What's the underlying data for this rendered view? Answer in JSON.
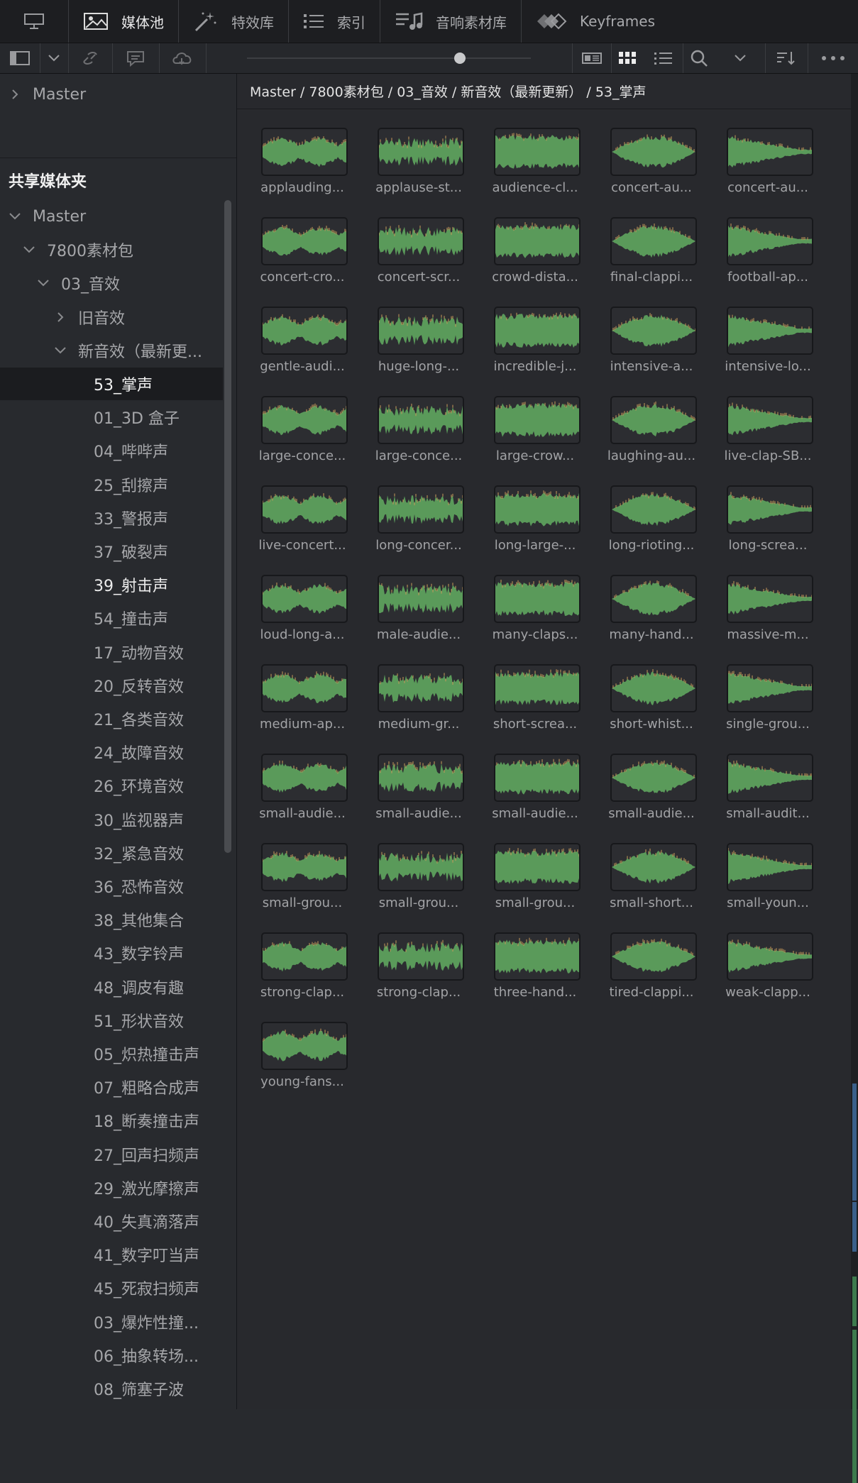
{
  "topbar": {
    "tabs": [
      {
        "label": "媒体池",
        "icon": "media-pool-icon",
        "active": true
      },
      {
        "label": "特效库",
        "icon": "effects-wand-icon",
        "active": false
      },
      {
        "label": "索引",
        "icon": "index-list-icon",
        "active": false
      },
      {
        "label": "音响素材库",
        "icon": "sound-library-icon",
        "active": false
      },
      {
        "label": "Keyframes",
        "icon": "keyframes-icon",
        "active": false
      }
    ]
  },
  "toolbar": {
    "icons": [
      "panel-layout-icon",
      "chevron-down-icon",
      "unlink-icon",
      "caption-icon",
      "cloud-icon",
      "zoom-slider",
      "metadata-view-icon",
      "grid-view-icon",
      "list-view-icon",
      "search-icon",
      "chevron-down-icon",
      "sort-icon",
      "more-options-icon"
    ]
  },
  "sidebar": {
    "master_top": "Master",
    "section_title": "共享媒体夹",
    "tree": [
      {
        "label": "Master",
        "chevron": "down",
        "level": 0
      },
      {
        "label": "7800素材包",
        "chevron": "down",
        "level": 1
      },
      {
        "label": "03_音效",
        "chevron": "down",
        "level": 2
      },
      {
        "label": "旧音效",
        "chevron": "right",
        "level": 3
      },
      {
        "label": "新音效（最新更...",
        "chevron": "down",
        "level": 3
      },
      {
        "label": "53_掌声",
        "level": 4,
        "selected": true
      },
      {
        "label": "01_3D 盒子",
        "level": 4
      },
      {
        "label": "04_哔哔声",
        "level": 4
      },
      {
        "label": "25_刮擦声",
        "level": 4
      },
      {
        "label": "33_警报声",
        "level": 4
      },
      {
        "label": "37_破裂声",
        "level": 4
      },
      {
        "label": "39_射击声",
        "level": 4,
        "bright": true
      },
      {
        "label": "54_撞击声",
        "level": 4
      },
      {
        "label": "17_动物音效",
        "level": 4
      },
      {
        "label": "20_反转音效",
        "level": 4
      },
      {
        "label": "21_各类音效",
        "level": 4
      },
      {
        "label": "24_故障音效",
        "level": 4
      },
      {
        "label": "26_环境音效",
        "level": 4
      },
      {
        "label": "30_监视器声",
        "level": 4
      },
      {
        "label": "32_紧急音效",
        "level": 4
      },
      {
        "label": "36_恐怖音效",
        "level": 4
      },
      {
        "label": "38_其他集合",
        "level": 4
      },
      {
        "label": "43_数字铃声",
        "level": 4
      },
      {
        "label": "48_调皮有趣",
        "level": 4
      },
      {
        "label": "51_形状音效",
        "level": 4
      },
      {
        "label": "05_炽热撞击声",
        "level": 4
      },
      {
        "label": "07_粗略合成声",
        "level": 4
      },
      {
        "label": "18_断奏撞击声",
        "level": 4
      },
      {
        "label": "27_回声扫频声",
        "level": 4
      },
      {
        "label": "29_激光摩擦声",
        "level": 4
      },
      {
        "label": "40_失真滴落声",
        "level": 4
      },
      {
        "label": "41_数字叮当声",
        "level": 4
      },
      {
        "label": "45_死寂扫频声",
        "level": 4
      },
      {
        "label": "03_爆炸性撞...",
        "level": 4
      },
      {
        "label": "06_抽象转场...",
        "level": 4
      },
      {
        "label": "08_筛塞子波",
        "level": 4
      }
    ]
  },
  "breadcrumb": "Master / 7800素材包 / 03_音效 / 新音效（最新更新） / 53_掌声",
  "clips": [
    "applauding...",
    "applause-st...",
    "audience-cl...",
    "concert-au...",
    "concert-au...",
    "concert-cro...",
    "concert-scr...",
    "crowd-dista...",
    "final-clappi...",
    "football-ap...",
    "gentle-audi...",
    "huge-long-...",
    "incredible-j...",
    "intensive-a...",
    "intensive-lo...",
    "large-conce...",
    "large-conce...",
    "large-crow...",
    "laughing-au...",
    "live-clap-SB...",
    "live-concert...",
    "long-concer...",
    "long-large-...",
    "long-rioting...",
    "long-screa...",
    "loud-long-a...",
    "male-audie...",
    "many-claps...",
    "many-hand...",
    "massive-m...",
    "medium-ap...",
    "medium-gr...",
    "short-screa...",
    "short-whist...",
    "single-grou...",
    "small-audie...",
    "small-audie...",
    "small-audie...",
    "small-audie...",
    "small-audit...",
    "small-grou...",
    "small-grou...",
    "small-grou...",
    "small-short...",
    "small-youn...",
    "strong-clap...",
    "strong-clap...",
    "three-hand...",
    "tired-clappi...",
    "weak-clapp...",
    "young-fans..."
  ],
  "colors": {
    "waveform": "#5a9a5a",
    "waveform_peak": "#c79a5a",
    "accent_blue": "#3a5f8a",
    "accent_green": "#3d7a4d"
  }
}
